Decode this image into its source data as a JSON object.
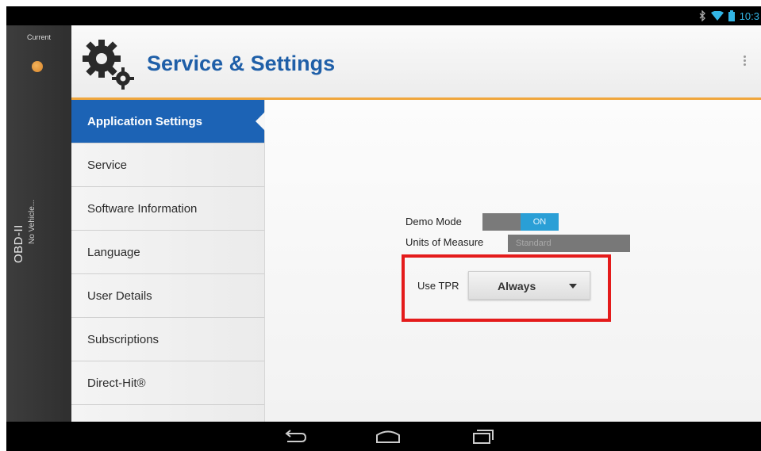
{
  "status_bar": {
    "time": "10:3",
    "icons": [
      "bluetooth-icon",
      "wifi-icon",
      "battery-icon"
    ]
  },
  "vehicle_rail": {
    "current_label": "Current",
    "protocol": "OBD-II",
    "vehicle": "No Vehicle..."
  },
  "header": {
    "title": "Service & Settings",
    "logo": "gears-icon",
    "overflow": "overflow-menu-icon"
  },
  "menu": {
    "items": [
      {
        "label": "Application Settings",
        "active": true
      },
      {
        "label": "Service"
      },
      {
        "label": "Software Information"
      },
      {
        "label": "Language"
      },
      {
        "label": "User Details"
      },
      {
        "label": "Subscriptions"
      },
      {
        "label": "Direct-Hit®"
      }
    ]
  },
  "settings": {
    "demo_mode": {
      "label": "Demo Mode",
      "value": "ON"
    },
    "units": {
      "label": "Units of Measure",
      "value": "Standard"
    },
    "tpr": {
      "label": "Use TPR",
      "value": "Always"
    }
  },
  "nav_bar": {
    "buttons": [
      "back-icon",
      "home-icon",
      "recents-icon"
    ]
  },
  "colors": {
    "title_blue": "#1f5fa8",
    "active_menu": "#1c63b5",
    "accent_orange": "#f0a63c",
    "toggle_on": "#2a9fd6",
    "highlight_red": "#e41b1b"
  }
}
